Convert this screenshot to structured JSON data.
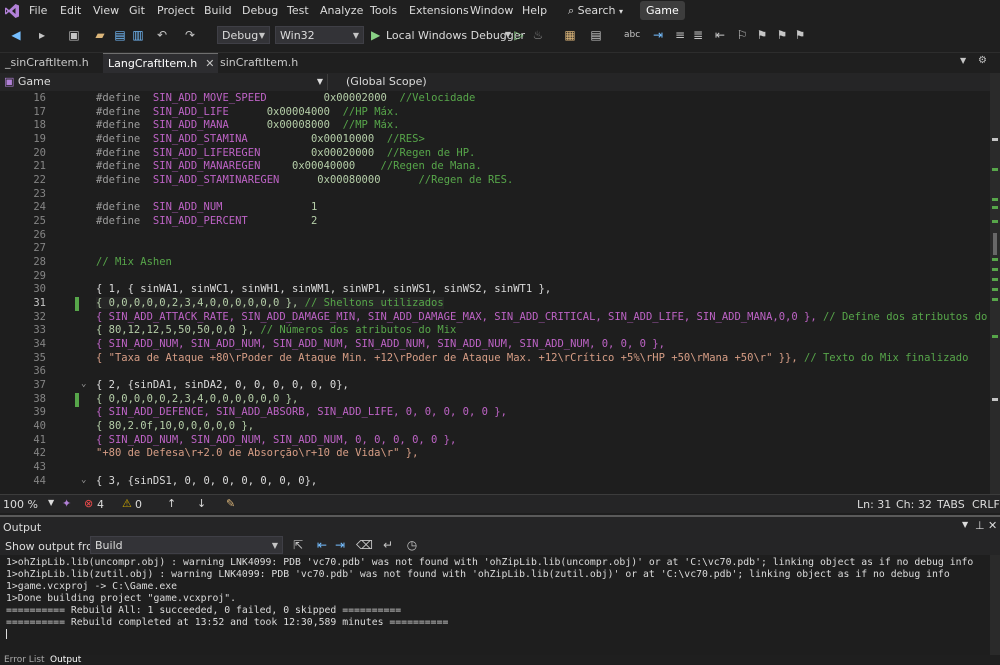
{
  "menu": {
    "items": [
      "File",
      "Edit",
      "View",
      "Git",
      "Project",
      "Build",
      "Debug",
      "Test",
      "Analyze",
      "Tools",
      "Extensions",
      "Window",
      "Help"
    ],
    "search_label": "Search",
    "solution_name": "Game"
  },
  "toolbar": {
    "config": "Debug",
    "platform": "Win32",
    "debugger_label": "Local Windows Debugger"
  },
  "tabs": [
    {
      "label": "_sinCraftItem.h",
      "active": false
    },
    {
      "label": "LangCraftItem.h",
      "active": true
    },
    {
      "label": "sinCraftItem.h",
      "active": false
    }
  ],
  "nav": {
    "project": "Game",
    "scope": "(Global Scope)"
  },
  "editor": {
    "line_numbers": [
      "16",
      "17",
      "18",
      "19",
      "20",
      "21",
      "22",
      "23",
      "24",
      "25",
      "26",
      "27",
      "28",
      "29",
      "30",
      "31",
      "32",
      "33",
      "34",
      "35",
      "36",
      "37",
      "38",
      "39",
      "40",
      "41",
      "42",
      "43",
      "44"
    ],
    "current_line": "31",
    "lines": {
      "l16": {
        "kw": "#define",
        "name": "SIN_ADD_MOVE_SPEED",
        "val": "0x00002000",
        "cmt": "//Velocidade"
      },
      "l17": {
        "kw": "#define",
        "name": "SIN_ADD_LIFE",
        "val": "0x00004000",
        "cmt": "//HP Máx."
      },
      "l18": {
        "kw": "#define",
        "name": "SIN_ADD_MANA",
        "val": "0x00008000",
        "cmt": "//MP Máx."
      },
      "l19": {
        "kw": "#define",
        "name": "SIN_ADD_STAMINA",
        "val": "0x00010000",
        "cmt": "//RES>"
      },
      "l20": {
        "kw": "#define",
        "name": "SIN_ADD_LIFEREGEN",
        "val": "0x00020000",
        "cmt": "//Regen de HP."
      },
      "l21": {
        "kw": "#define",
        "name": "SIN_ADD_MANAREGEN",
        "val": "0x00040000",
        "cmt": "//Regen de Mana."
      },
      "l22": {
        "kw": "#define",
        "name": "SIN_ADD_STAMINAREGEN",
        "val": "0x00080000",
        "cmt": "//Regen de RES."
      },
      "l24": {
        "kw": "#define",
        "name": "SIN_ADD_NUM",
        "val": "1"
      },
      "l25": {
        "kw": "#define",
        "name": "SIN_ADD_PERCENT",
        "val": "2"
      },
      "l28": {
        "cmt": "// Mix Ashen"
      },
      "l30": "{ 1, { sinWA1, sinWC1, sinWH1, sinWM1, sinWP1, sinWS1, sinWS2, sinWT1 },",
      "l31": {
        "code": "{ 0,0,0,0,0,2,3,4,0,0,0,0,0,0 },",
        "cmt": " // Sheltons utilizados"
      },
      "l32": {
        "code": "{ SIN_ADD_ATTACK_RATE, SIN_ADD_DAMAGE_MIN, SIN_ADD_DAMAGE_MAX, SIN_ADD_CRITICAL, SIN_ADD_LIFE, SIN_ADD_MANA,0,0 },",
        "cmt": " // Define dos atributos do Mi"
      },
      "l33": {
        "code": "{ 80,12,12,5,50,50,0,0 },",
        "cmt": " // Números dos atributos do Mix"
      },
      "l34": "{ SIN_ADD_NUM, SIN_ADD_NUM, SIN_ADD_NUM, SIN_ADD_NUM, SIN_ADD_NUM, SIN_ADD_NUM, 0, 0, 0 },",
      "l35": {
        "str": "{ \"Taxa de Ataque +80\\rPoder de Ataque Min. +12\\rPoder de Ataque Max. +12\\rCrítico +5%\\rHP +50\\rMana +50\\r\" }},",
        "cmt": " // Texto do Mix finalizado"
      },
      "l37": "{ 2, {sinDA1, sinDA2, 0, 0, 0, 0, 0, 0},",
      "l38": "{ 0,0,0,0,0,2,3,4,0,0,0,0,0,0 },",
      "l39": "{ SIN_ADD_DEFENCE, SIN_ADD_ABSORB, SIN_ADD_LIFE, 0, 0, 0, 0, 0 },",
      "l40": "{ 80,2.0f,10,0,0,0,0,0 },",
      "l41": "{ SIN_ADD_NUM, SIN_ADD_NUM, SIN_ADD_NUM, 0, 0, 0, 0, 0 },",
      "l42": "\"+80 de Defesa\\r+2.0 de Absorção\\r+10 de Vida\\r\" },",
      "l44": "{ 3, {sinDS1, 0, 0, 0, 0, 0, 0, 0},"
    }
  },
  "status": {
    "zoom": "100 %",
    "errors": "4",
    "warnings": "0",
    "line": "Ln: 31",
    "col": "Ch: 32",
    "tabs": "TABS",
    "eol": "CRLF"
  },
  "output": {
    "title": "Output",
    "show_from_label": "Show output from:",
    "source": "Build",
    "lines": [
      "1>ohZipLib.lib(uncompr.obj) : warning LNK4099: PDB 'vc70.pdb' was not found with 'ohZipLib.lib(uncompr.obj)' or at 'C:\\vc70.pdb'; linking object as if no debug info",
      "1>ohZipLib.lib(zutil.obj) : warning LNK4099: PDB 'vc70.pdb' was not found with 'ohZipLib.lib(zutil.obj)' or at 'C:\\vc70.pdb'; linking object as if no debug info",
      "1>game.vcxproj -> C:\\Game.exe",
      "1>Done building project \"game.vcxproj\".",
      "========== Rebuild All: 1 succeeded, 0 failed, 0 skipped ==========",
      "========== Rebuild completed at 13:52 and took 12:30,589 minutes =========="
    ]
  },
  "bottom_tabs": [
    "Error List",
    "Output"
  ]
}
